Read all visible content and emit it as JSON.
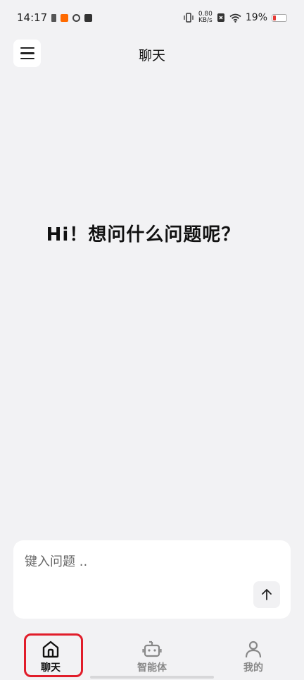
{
  "status_bar": {
    "time": "14:17",
    "net_speed": "0.80",
    "net_unit": "KB/s",
    "battery_percent": "19%",
    "battery_color": "#e53935"
  },
  "header": {
    "title": "聊天",
    "menu_icon": "hamburger-menu-icon"
  },
  "greeting": "Hi！想问什么问题呢？",
  "composer": {
    "placeholder": "键入问题 ..",
    "value": "",
    "send_icon": "arrow-up-icon"
  },
  "bottom_nav": {
    "items": [
      {
        "label": "聊天",
        "icon": "home-icon",
        "active": true
      },
      {
        "label": "智能体",
        "icon": "robot-icon",
        "active": false
      },
      {
        "label": "我的",
        "icon": "person-icon",
        "active": false
      }
    ]
  },
  "highlight_color": "#e11d2a"
}
